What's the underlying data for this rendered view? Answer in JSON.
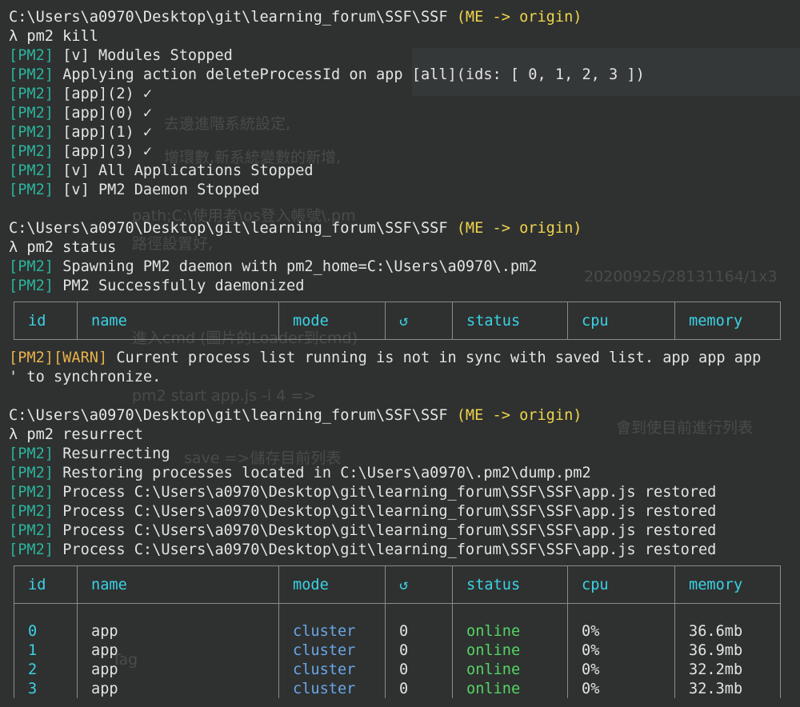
{
  "colors": {
    "background": "#2e3130",
    "prompt_path": "#e6e6e6",
    "branch": "#f0d44c",
    "pm2_tag": "#2bb39c",
    "warn": "#e8b14b",
    "table_header": "#3cd2e6",
    "mode": "#6aa6e8",
    "status_online": "#55d464"
  },
  "prompts": [
    {
      "path": "C:\\Users\\a0970\\Desktop\\git\\learning_forum\\SSF\\SSF",
      "branch": "(ME -> origin)",
      "cmd": "λ pm2 kill"
    },
    {
      "path": "C:\\Users\\a0970\\Desktop\\git\\learning_forum\\SSF\\SSF",
      "branch": "(ME -> origin)",
      "cmd": "λ pm2 status"
    },
    {
      "path": "C:\\Users\\a0970\\Desktop\\git\\learning_forum\\SSF\\SSF",
      "branch": "(ME -> origin)",
      "cmd": "λ pm2 resurrect"
    }
  ],
  "pm2_tag": "[PM2]",
  "warn_tag": "[WARN]",
  "kill_output": [
    "[v] Modules Stopped",
    "Applying action deleteProcessId on app [all](ids: [ 0, 1, 2, 3 ])",
    "[app](2) ✓",
    "[app](0) ✓",
    "[app](1) ✓",
    "[app](3) ✓",
    "[v] All Applications Stopped",
    "[v] PM2 Daemon Stopped"
  ],
  "status_output": [
    "Spawning PM2 daemon with pm2_home=C:\\Users\\a0970\\.pm2",
    "PM2 Successfully daemonized"
  ],
  "warn_line1": "Current process list running is not in sync with saved list. app app app",
  "warn_line2": "' to synchronize.",
  "resurrect_output": [
    "Resurrecting",
    "Restoring processes located in C:\\Users\\a0970\\.pm2\\dump.pm2",
    "Process C:\\Users\\a0970\\Desktop\\git\\learning_forum\\SSF\\SSF\\app.js restored",
    "Process C:\\Users\\a0970\\Desktop\\git\\learning_forum\\SSF\\SSF\\app.js restored",
    "Process C:\\Users\\a0970\\Desktop\\git\\learning_forum\\SSF\\SSF\\app.js restored",
    "Process C:\\Users\\a0970\\Desktop\\git\\learning_forum\\SSF\\SSF\\app.js restored"
  ],
  "table": {
    "headers": [
      "id",
      "name",
      "mode",
      "↺",
      "status",
      "cpu",
      "memory"
    ],
    "rows": [
      [
        "0",
        "app",
        "cluster",
        "0",
        "online",
        "0%",
        "36.6mb"
      ],
      [
        "1",
        "app",
        "cluster",
        "0",
        "online",
        "0%",
        "36.9mb"
      ],
      [
        "2",
        "app",
        "cluster",
        "0",
        "online",
        "0%",
        "32.2mb"
      ],
      [
        "3",
        "app",
        "cluster",
        "0",
        "online",
        "0%",
        "32.3mb"
      ]
    ]
  },
  "ghost": {
    "line1": "去邊進階系統設定,",
    "line2": "增環數,新系統變數的新增,",
    "line3": "path;C:\\使用者\\os登入帳號\\.pm",
    "line4": "路徑設置好,",
    "line5": "20200925/28131164/1x3",
    "line6": "進入cmd (圖片的Loader到cmd)",
    "line7": "pm2 start app.js -i 4 =>",
    "line8": "會到使目前進行列表",
    "line9": "save =>儲存目前列表",
    "line10": "Tag"
  }
}
